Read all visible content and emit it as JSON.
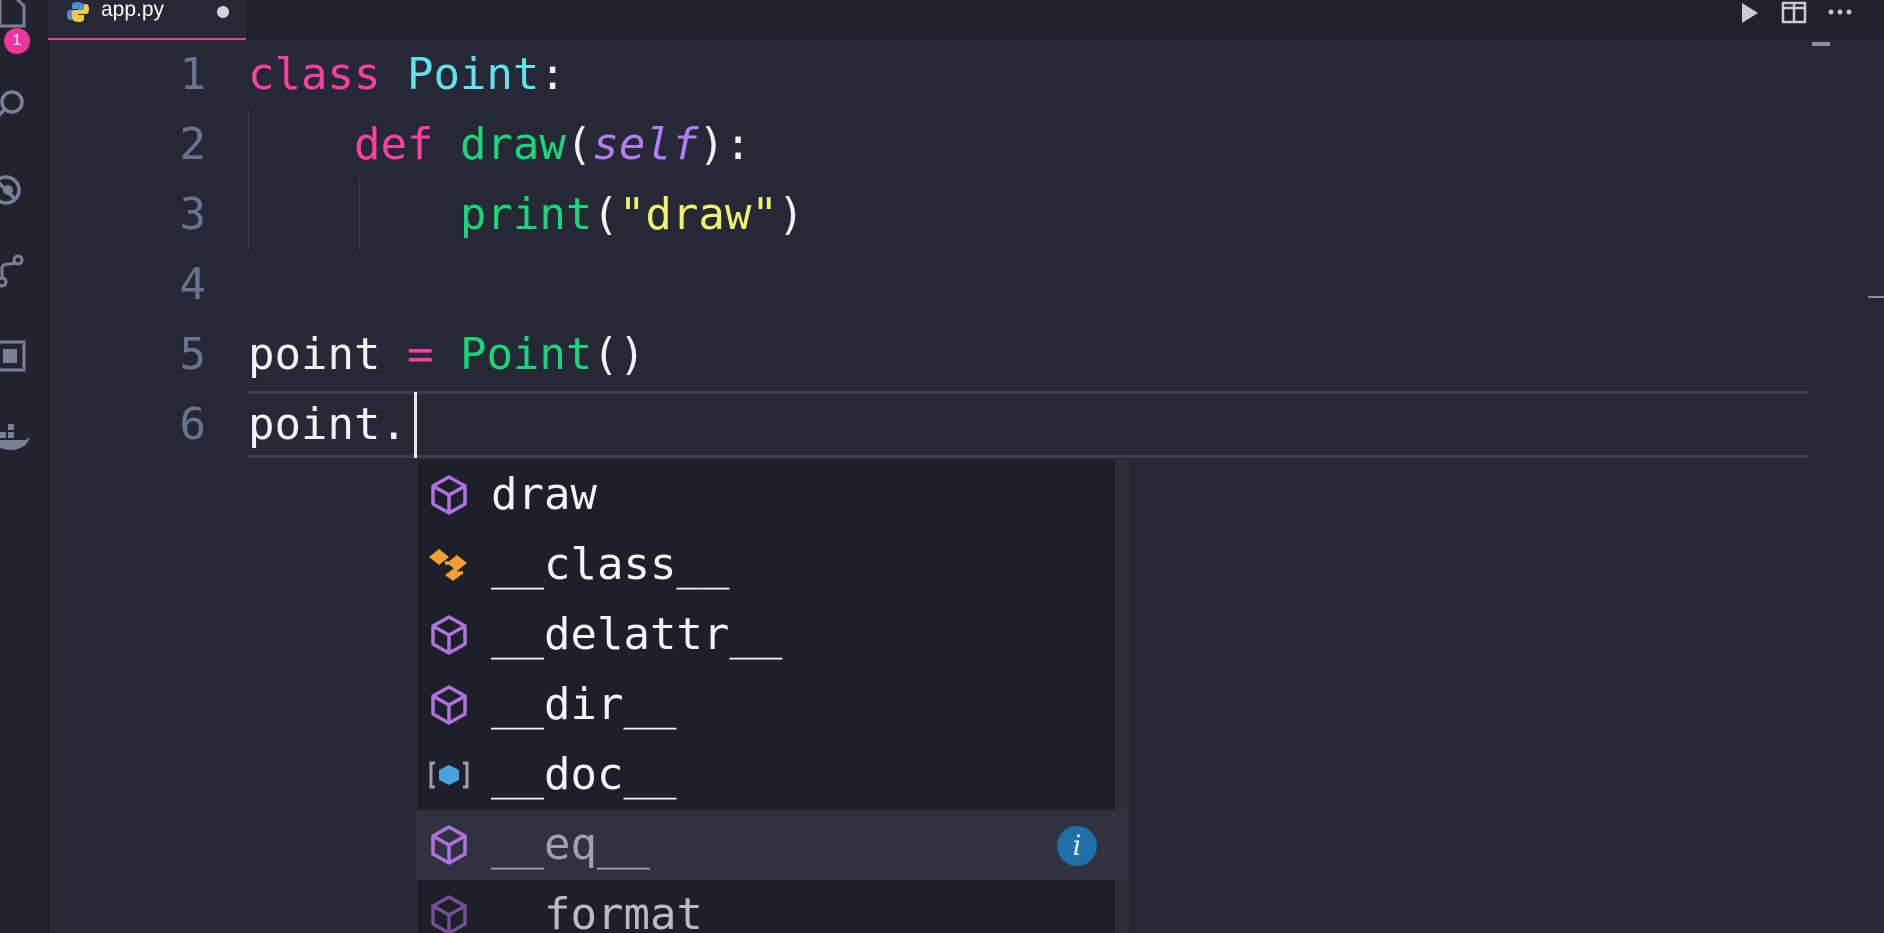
{
  "activity_bar": {
    "notification_count": "1",
    "icons": [
      "explorer-icon",
      "search-icon",
      "debug-icon",
      "source-control-icon",
      "extensions-icon",
      "docker-icon"
    ]
  },
  "tab": {
    "filename": "app.py",
    "language_icon": "python-icon",
    "unsaved": true
  },
  "title_actions": [
    "run-icon",
    "split-editor-icon",
    "more-icon"
  ],
  "editor": {
    "lines": [
      {
        "number": "1",
        "tokens": [
          {
            "t": "class",
            "c": "kw"
          },
          {
            "t": " ",
            "c": "pl"
          },
          {
            "t": "Point",
            "c": "cls"
          },
          {
            "t": ":",
            "c": "pl"
          }
        ]
      },
      {
        "number": "2",
        "tokens": [
          {
            "t": "    ",
            "c": "pl"
          },
          {
            "t": "def",
            "c": "kw"
          },
          {
            "t": " ",
            "c": "pl"
          },
          {
            "t": "draw",
            "c": "fn"
          },
          {
            "t": "(",
            "c": "pl"
          },
          {
            "t": "self",
            "c": "self"
          },
          {
            "t": "):",
            "c": "pl"
          }
        ]
      },
      {
        "number": "3",
        "tokens": [
          {
            "t": "        ",
            "c": "pl"
          },
          {
            "t": "print",
            "c": "fn"
          },
          {
            "t": "(",
            "c": "pl"
          },
          {
            "t": "\"draw\"",
            "c": "str"
          },
          {
            "t": ")",
            "c": "pl"
          }
        ]
      },
      {
        "number": "4",
        "tokens": []
      },
      {
        "number": "5",
        "tokens": [
          {
            "t": "point ",
            "c": "pl"
          },
          {
            "t": "=",
            "c": "op"
          },
          {
            "t": " ",
            "c": "pl"
          },
          {
            "t": "Point",
            "c": "fn"
          },
          {
            "t": "()",
            "c": "pl"
          }
        ]
      },
      {
        "number": "6",
        "tokens": [
          {
            "t": "point.",
            "c": "pl"
          }
        ]
      }
    ]
  },
  "suggestions": [
    {
      "label": "draw",
      "kind": "method-icon",
      "state": "normal"
    },
    {
      "label": "__class__",
      "kind": "class-icon",
      "state": "normal"
    },
    {
      "label": "__delattr__",
      "kind": "method-icon",
      "state": "normal"
    },
    {
      "label": "__dir__",
      "kind": "method-icon",
      "state": "normal"
    },
    {
      "label": "__doc__",
      "kind": "variable-icon",
      "state": "normal"
    },
    {
      "label": "__eq__",
      "kind": "method-icon",
      "state": "selected",
      "info": "i"
    },
    {
      "label": "__format__",
      "kind": "method-icon",
      "state": "dim"
    }
  ],
  "colors": {
    "keyword": "#ff3ea6",
    "class_name": "#5fe3f0",
    "function": "#17d77b",
    "self": "#b57cf7",
    "string": "#eef26f",
    "method_icon": "#b072e0",
    "class_icon": "#f0a030",
    "variable_icon": "#4aa0e0"
  }
}
